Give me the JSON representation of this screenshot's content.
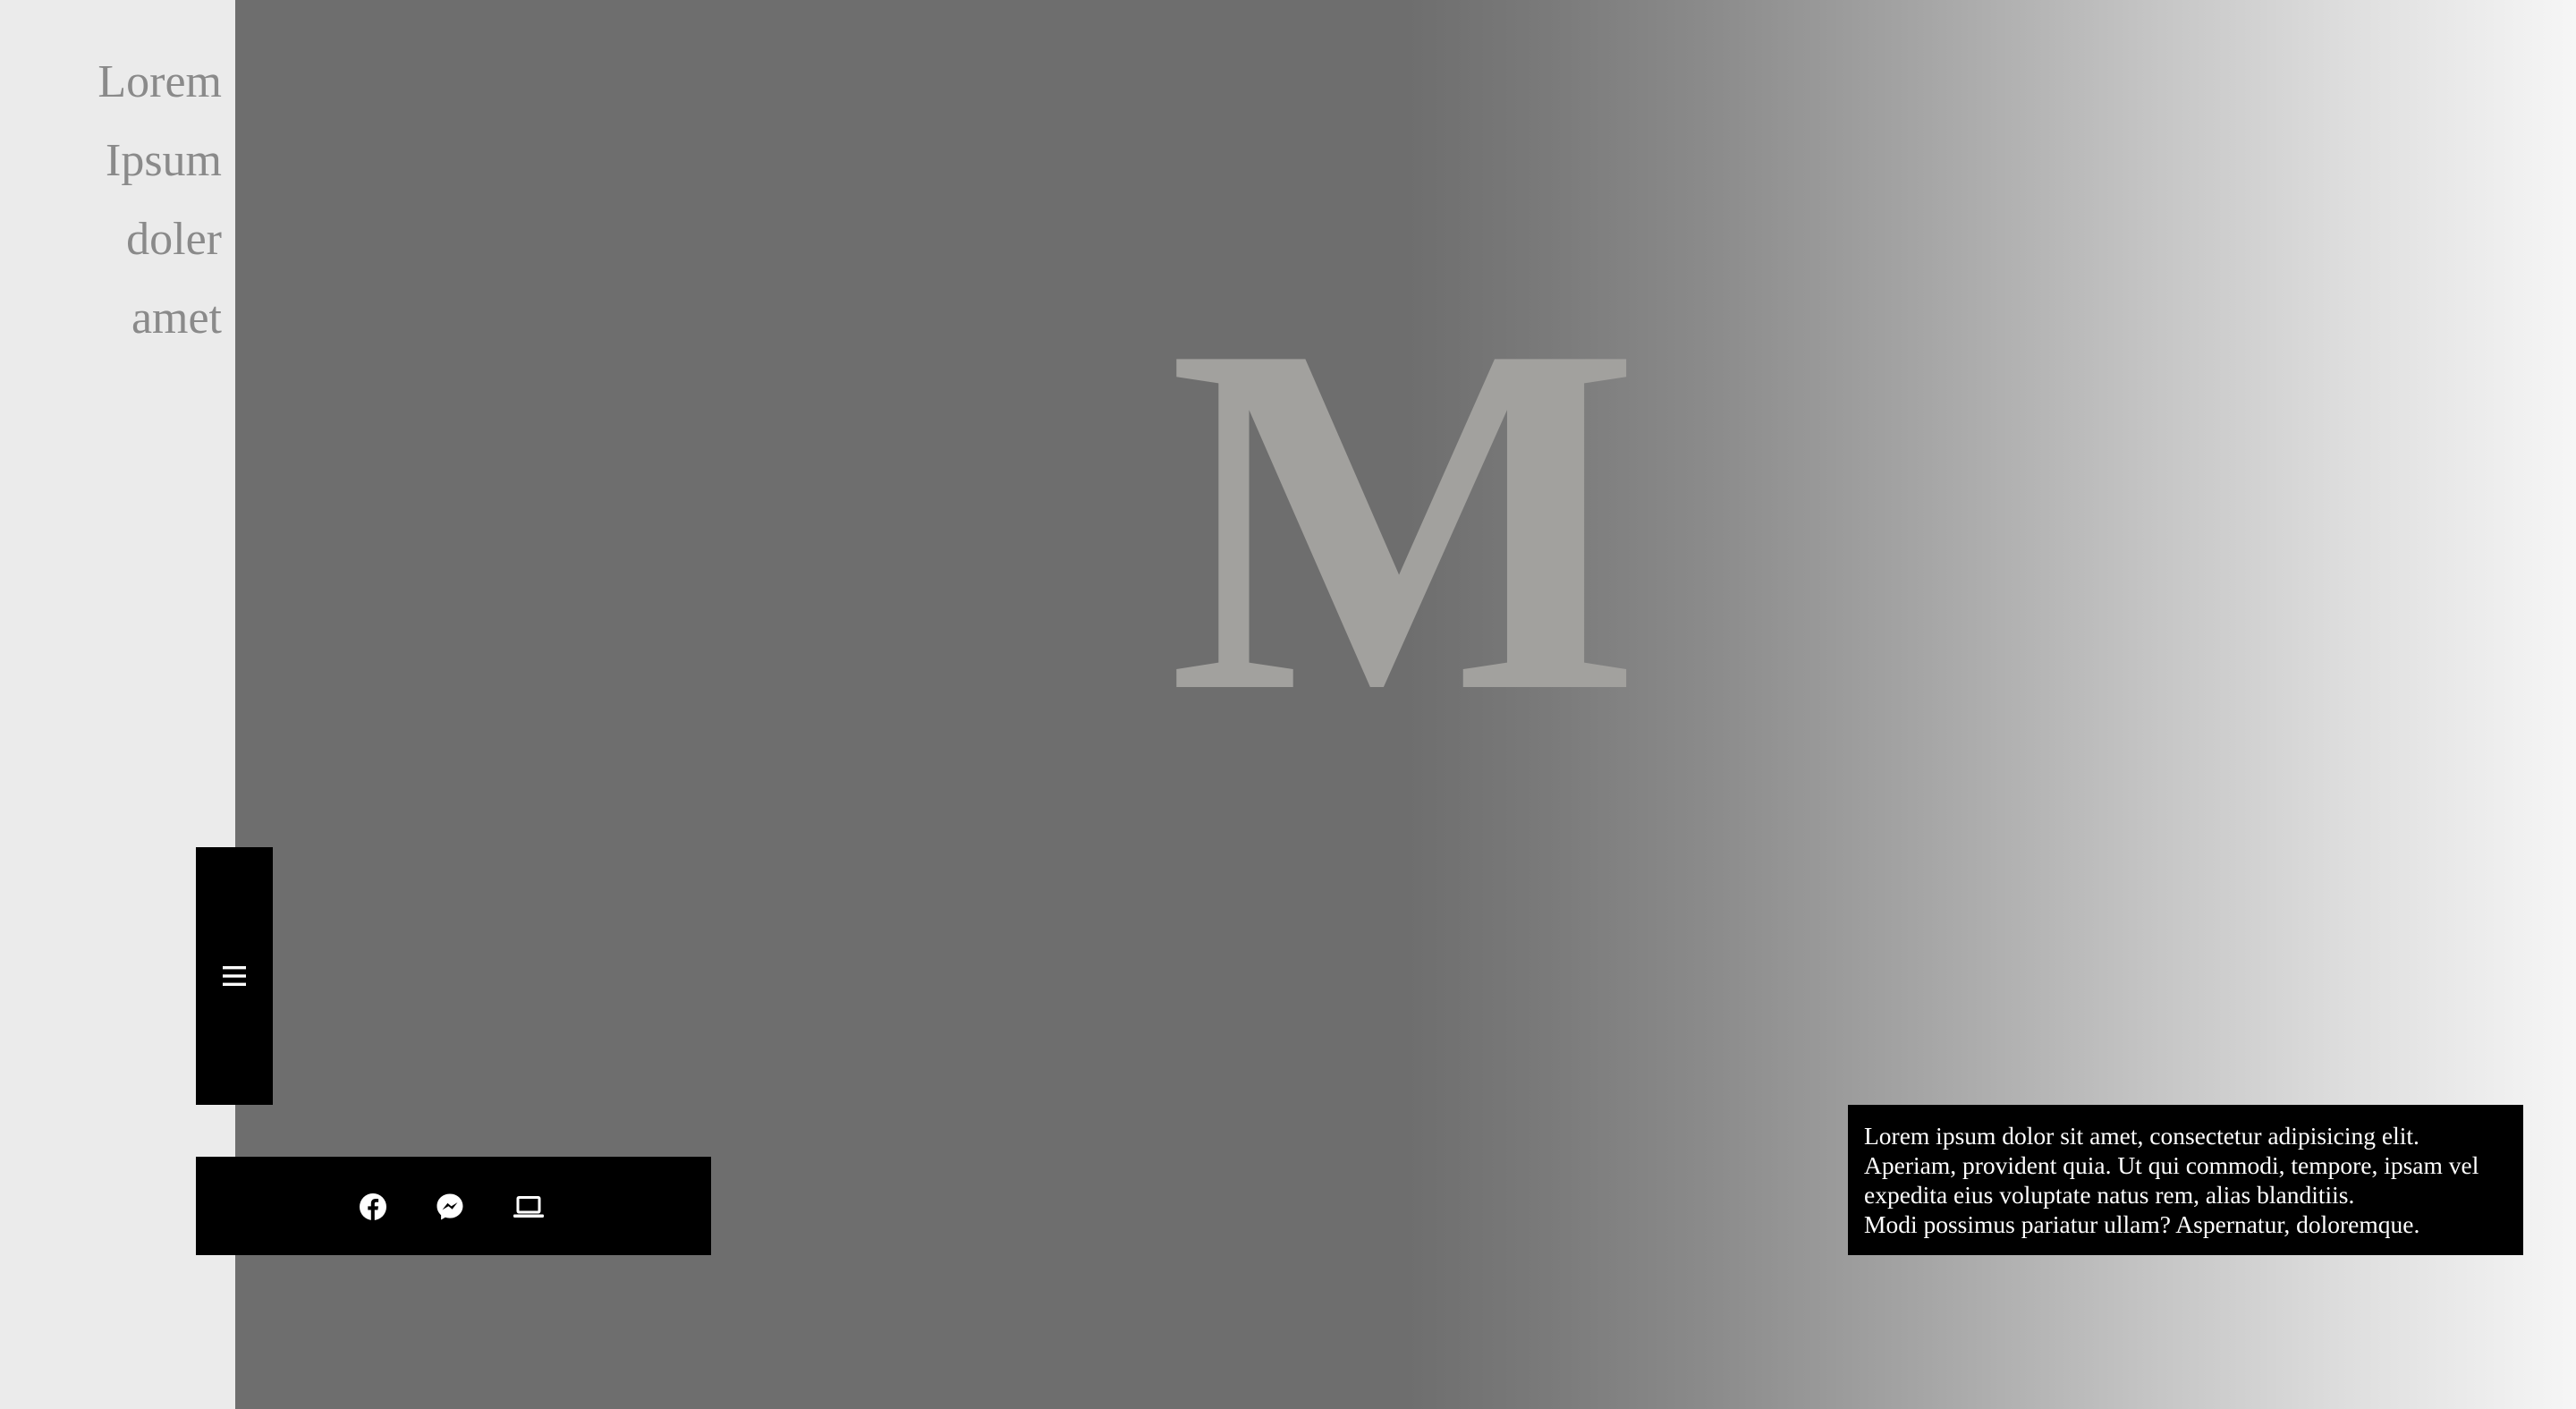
{
  "nav": {
    "items": [
      {
        "label": "Lorem"
      },
      {
        "label": "Ipsum"
      },
      {
        "label": "doler"
      },
      {
        "label": "amet"
      }
    ]
  },
  "hero": {
    "letter": "M",
    "colors": {
      "left_panel": "#ebebeb",
      "dark": "#6e6e6e",
      "light": "#f6f6f6",
      "letter": "#a2a19e"
    }
  },
  "menu_toggle": {
    "icon": "hamburger-menu-icon"
  },
  "social": {
    "icons": [
      "facebook-icon",
      "messenger-icon",
      "laptop-icon"
    ]
  },
  "info": {
    "line1": "Lorem ipsum dolor sit amet, consectetur adipisicing elit. Aperiam, provident quia. Ut qui commodi, tempore, ipsam vel expedita eius voluptate natus rem, alias blanditiis.",
    "line2": "Modi possimus pariatur ullam? Aspernatur, doloremque."
  }
}
